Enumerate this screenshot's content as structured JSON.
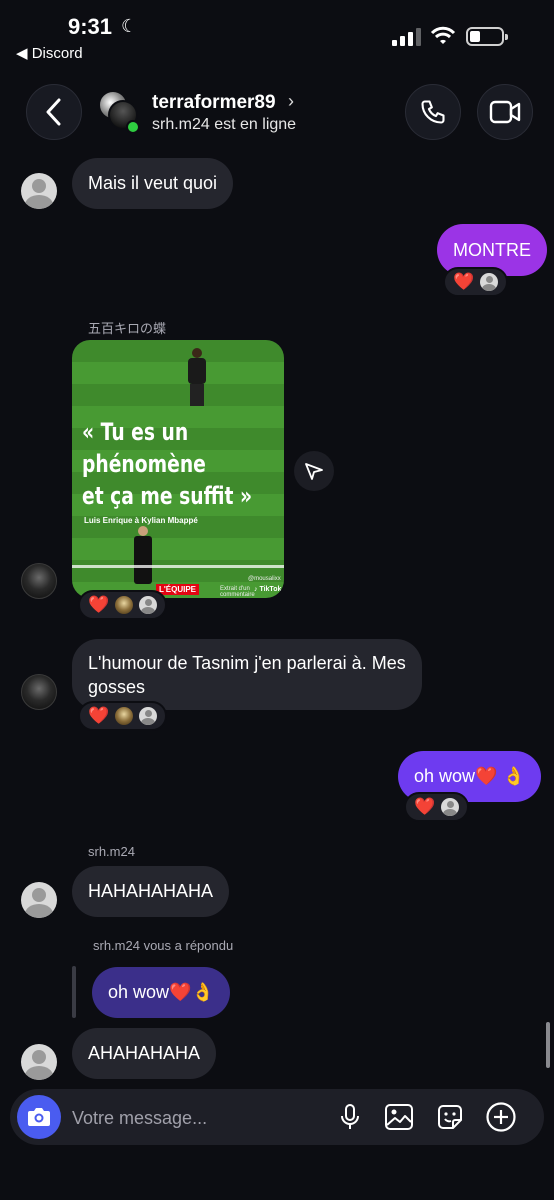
{
  "status_bar": {
    "time": "9:31",
    "back_app": "◀ Discord"
  },
  "header": {
    "contact_name": "terraformer89",
    "status": "srh.m24 est en ligne"
  },
  "messages": {
    "m1": {
      "text": "Mais il veut quoi"
    },
    "m2": {
      "text": "MONTRE"
    },
    "shared_sender": "五百キロの蝶",
    "post": {
      "quote_line1": "« Tu es un",
      "quote_line2": "phénomène",
      "quote_line3": "et ça me suffit »",
      "caption": "Luis Enrique à Kylian Mbappé",
      "logo": "L'ÉQUIPE",
      "sub": "Extrait d'un commentaire",
      "handle": "@mousalixx",
      "tiktok": "♪ TikTok"
    },
    "m3": {
      "text_line1": "L'humour de Tasnim j'en parlerai à. Mes",
      "text_line2": "gosses"
    },
    "m4": {
      "text": "oh wow❤️ 👌"
    },
    "sender_srh": "srh.m24",
    "m5": {
      "text": "HAHAHAHAHA"
    },
    "reply_label": "srh.m24 vous a répondu",
    "reply_quote": "oh wow❤️👌",
    "m6": {
      "text": "AHAHAHAHA"
    }
  },
  "reactions": {
    "heart": "❤️"
  },
  "composer": {
    "placeholder": "Votre message..."
  },
  "colors": {
    "accent": "#4a5cf0",
    "out_pink": "#9b34e6",
    "out_violet": "#6e3bf0",
    "online": "#2ecc40"
  }
}
